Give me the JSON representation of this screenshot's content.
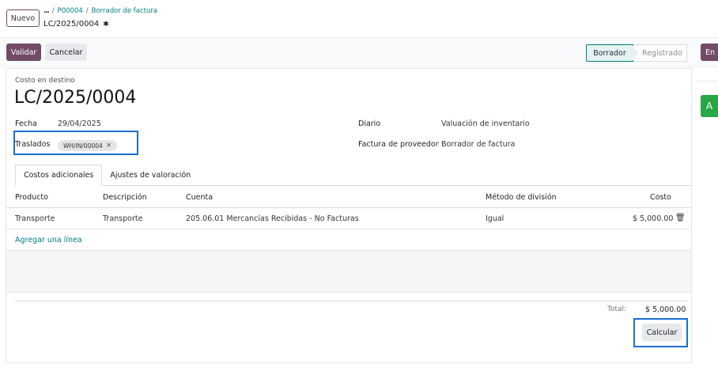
{
  "header": {
    "new_button": "Nuevo",
    "breadcrumb_dots": "...",
    "breadcrumb_sep1": "/",
    "breadcrumb_po": "P00004",
    "breadcrumb_sep2": "/",
    "breadcrumb_bill": "Borrador de factura",
    "record_name": "LC/2025/0004"
  },
  "actions": {
    "validate": "Validar",
    "cancel": "Cancelar",
    "right_button": "En"
  },
  "status": {
    "steps": [
      "Borrador",
      "Registrado"
    ],
    "current": "Borrador"
  },
  "form": {
    "subtitle": "Costo en destino",
    "title": "LC/2025/0004",
    "fields": {
      "date_label": "Fecha",
      "date_value": "29/04/2025",
      "transfers_label": "Traslados",
      "transfer_tag": "WH/IN/00004",
      "journal_label": "Diario",
      "journal_value": "Valuación de inventario",
      "vendor_bill_label": "Factura de proveedor",
      "vendor_bill_value": "Borrador de factura"
    }
  },
  "tabs": [
    "Costos adicionales",
    "Ajustes de valoración"
  ],
  "table": {
    "columns": [
      "Producto",
      "Descripción",
      "Cuenta",
      "Método de división",
      "Costo"
    ],
    "rows": [
      [
        "Transporte",
        "Transporte",
        "205.06.01 Mercancías Recibidas - No Facturas",
        "Igual",
        "$ 5,000.00"
      ]
    ],
    "add_line": "Agregar una línea"
  },
  "totals": {
    "label": "Total:",
    "value": "$ 5,000.00"
  },
  "compute_button": "Calcular",
  "side": {
    "green_button": "A"
  },
  "colors": {
    "primary": "#714b67",
    "teal": "#017e84",
    "highlight": "#1a6fd1",
    "green": "#28a745"
  }
}
